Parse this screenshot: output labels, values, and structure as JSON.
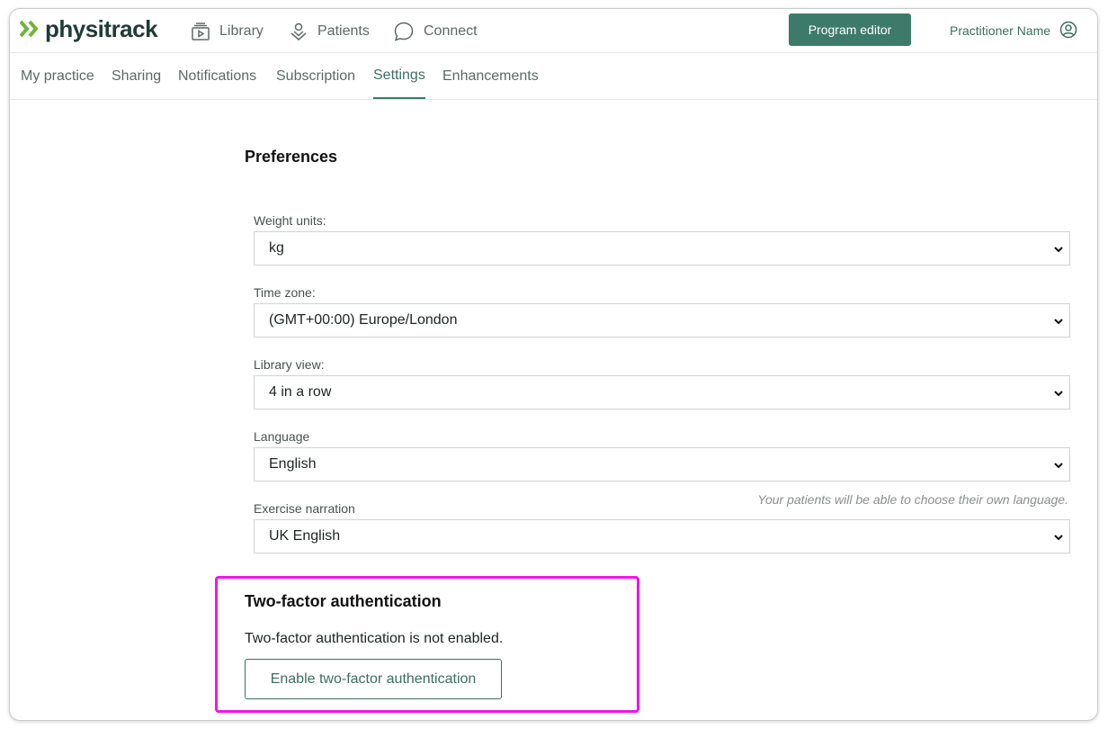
{
  "app": {
    "brand": "physitrack",
    "accent_color": "#3d7a69",
    "logo_color": "#6fb63a"
  },
  "topnav": {
    "library_label": "Library",
    "patients_label": "Patients",
    "connect_label": "Connect",
    "program_editor_label": "Program editor",
    "user_name": "Practitioner Name"
  },
  "tabs": [
    {
      "label": "My practice",
      "active": false
    },
    {
      "label": "Sharing",
      "active": false
    },
    {
      "label": "Notifications",
      "active": false
    },
    {
      "label": "Subscription",
      "active": false
    },
    {
      "label": "Settings",
      "active": true
    },
    {
      "label": "Enhancements",
      "active": false
    }
  ],
  "preferences": {
    "heading": "Preferences",
    "fields": [
      {
        "label": "Weight units:",
        "value": "kg"
      },
      {
        "label": "Time zone:",
        "value": "(GMT+00:00) Europe/London"
      },
      {
        "label": "Library view:",
        "value": "4 in a row"
      },
      {
        "label": "Language",
        "value": "English"
      },
      {
        "label": "Exercise narration",
        "value": "UK English"
      }
    ],
    "language_hint": "Your patients will be able to choose their own language."
  },
  "two_factor": {
    "heading": "Two-factor authentication",
    "status_text": "Two-factor authentication is not enabled.",
    "enable_button_label": "Enable two-factor authentication",
    "highlight_color": "#ee16e8"
  }
}
